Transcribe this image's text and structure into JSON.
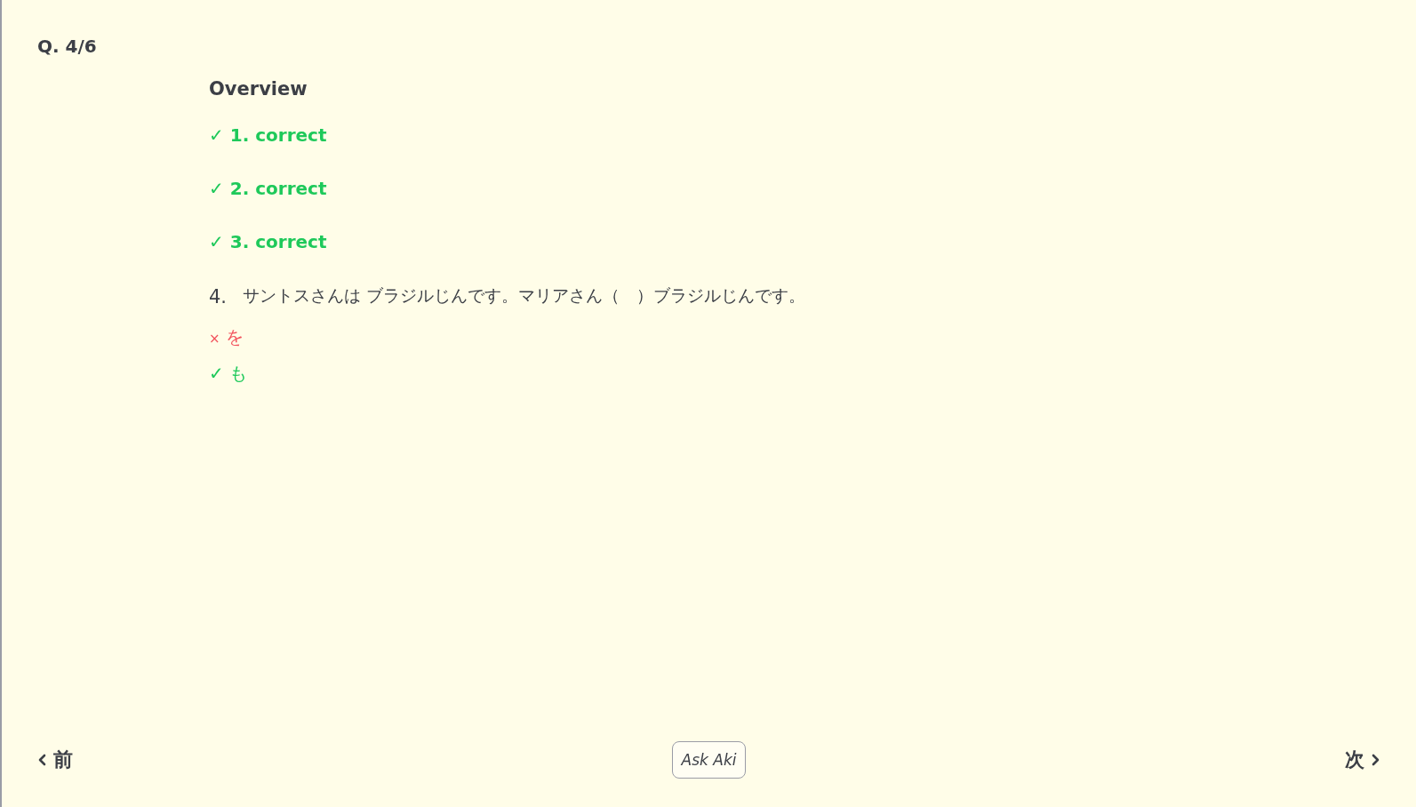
{
  "header": {
    "counter": "Q. 4/6"
  },
  "overview": {
    "title": "Overview",
    "results": [
      {
        "mark": "✓",
        "label": "1. correct",
        "kind": "correct"
      },
      {
        "mark": "✓",
        "label": "2. correct",
        "kind": "correct"
      },
      {
        "mark": "✓",
        "label": "3. correct",
        "kind": "correct"
      }
    ]
  },
  "question": {
    "number": "4.",
    "text": "サントスさんは ブラジルじんです。マリアさん（　）ブラジルじんです。",
    "answers": [
      {
        "mark": "×",
        "text": "を",
        "kind": "wrong"
      },
      {
        "mark": "✓",
        "text": "も",
        "kind": "right"
      }
    ]
  },
  "footer": {
    "prev": "前",
    "ask": "Ask Aki",
    "next": "次"
  }
}
